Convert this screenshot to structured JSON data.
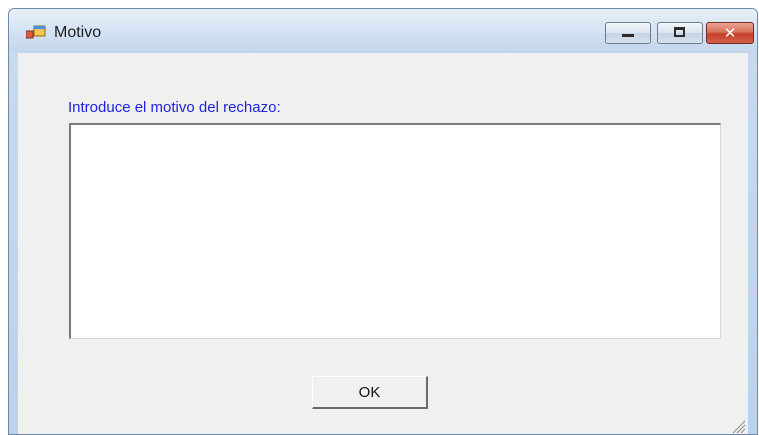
{
  "window": {
    "title": "Motivo",
    "icon": "windows-form-icon",
    "controls": {
      "minimize": "minimize-icon",
      "maximize": "maximize-icon",
      "close": "close-icon",
      "close_glyph": "✕"
    }
  },
  "form": {
    "prompt_label": "Introduce el motivo del rechazo:",
    "reason_value": "",
    "ok_label": "OK"
  },
  "colors": {
    "label_text": "#2222dd",
    "client_background": "#f0f0f0",
    "close_button": "#c4402a"
  }
}
